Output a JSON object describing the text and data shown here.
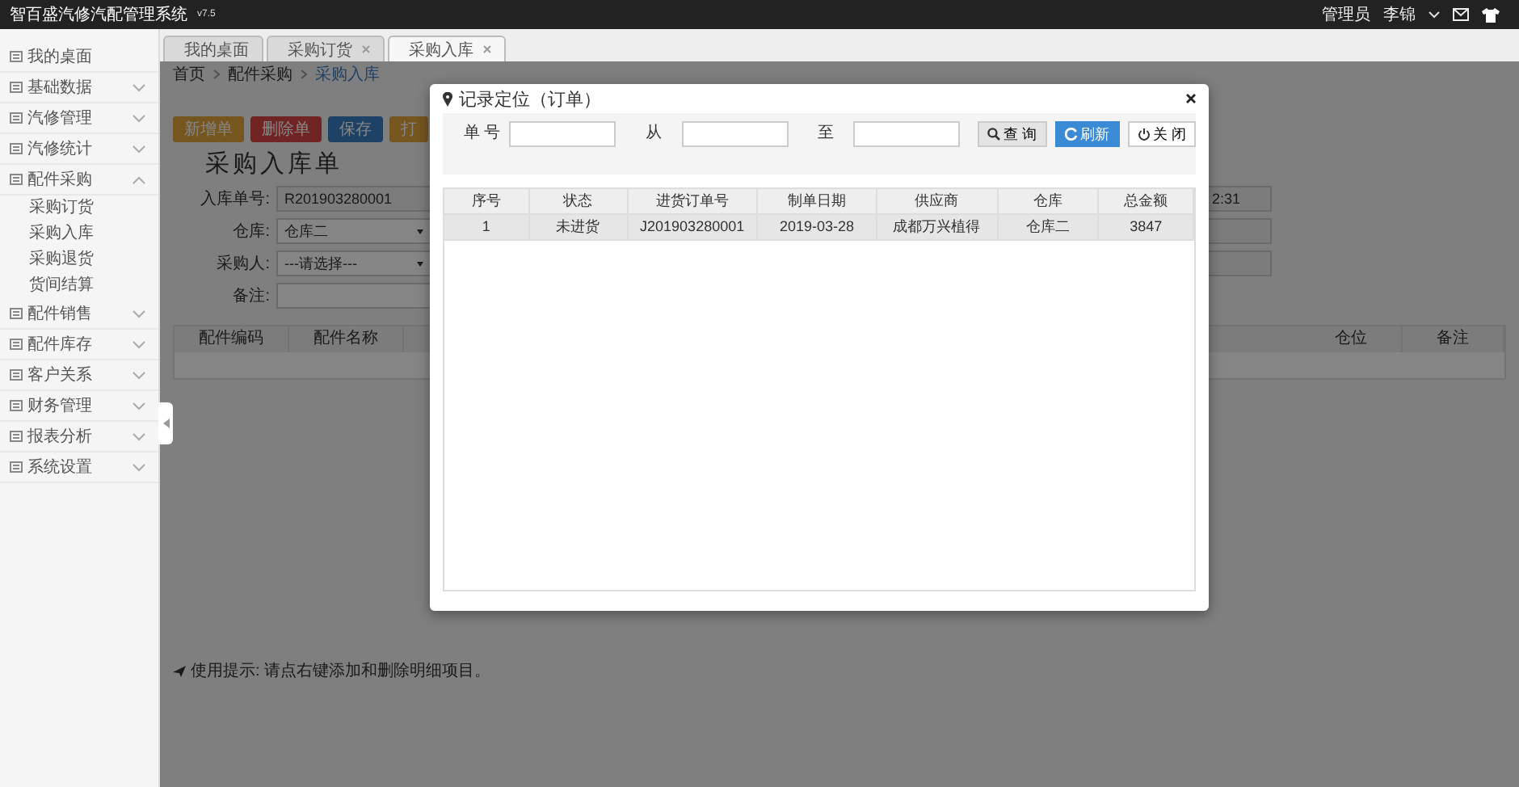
{
  "app": {
    "title": "智百盛汽修汽配管理系统",
    "version": "v7.5"
  },
  "user": {
    "role": "管理员",
    "name": "李锦"
  },
  "sidebar": {
    "items": [
      {
        "label": "我的桌面",
        "kind": "link"
      },
      {
        "label": "基础数据",
        "kind": "group",
        "expanded": false
      },
      {
        "label": "汽修管理",
        "kind": "group",
        "expanded": false
      },
      {
        "label": "汽修统计",
        "kind": "group",
        "expanded": false
      },
      {
        "label": "配件采购",
        "kind": "group",
        "expanded": true,
        "children": [
          {
            "label": "采购订货"
          },
          {
            "label": "采购入库"
          },
          {
            "label": "采购退货"
          },
          {
            "label": "货间结算"
          }
        ]
      },
      {
        "label": "配件销售",
        "kind": "group",
        "expanded": false
      },
      {
        "label": "配件库存",
        "kind": "group",
        "expanded": false
      },
      {
        "label": "客户关系",
        "kind": "group",
        "expanded": false
      },
      {
        "label": "财务管理",
        "kind": "group",
        "expanded": false
      },
      {
        "label": "报表分析",
        "kind": "group",
        "expanded": false
      },
      {
        "label": "系统设置",
        "kind": "group",
        "expanded": false
      }
    ]
  },
  "tabs": [
    {
      "label": "我的桌面",
      "closable": false,
      "selected": false
    },
    {
      "label": "采购订货",
      "closable": true,
      "selected": false
    },
    {
      "label": "采购入库",
      "closable": true,
      "selected": true
    }
  ],
  "breadcrumb": [
    "首页",
    "配件采购",
    "采购入库"
  ],
  "toolbar": [
    {
      "label": "新增单",
      "kind": "add"
    },
    {
      "label": "删除单",
      "kind": "delete"
    },
    {
      "label": "保存",
      "kind": "save"
    },
    {
      "label": "打",
      "kind": "print"
    }
  ],
  "form": {
    "title": "采购入库单",
    "fields": [
      {
        "label": "入库单号:",
        "value": "R201903280001",
        "kind": "readonly"
      },
      {
        "label": "仓库:",
        "value": "仓库二",
        "kind": "select"
      },
      {
        "label": "采购人:",
        "value": "---请选择---",
        "kind": "select"
      },
      {
        "label": "备注:",
        "kind": "text"
      }
    ],
    "right_value": "2:31"
  },
  "detail_table": {
    "left_columns": [
      "配件编码",
      "配件名称"
    ],
    "right_columns": [
      "仓位",
      "备注"
    ]
  },
  "tip": "使用提示: 请点右键添加和删除明细项目。",
  "dialog": {
    "title": "记录定位（订单）",
    "search_fields": [
      {
        "label": "单 号"
      },
      {
        "label": "从"
      },
      {
        "label": "至"
      }
    ],
    "buttons": [
      {
        "label": "查 询",
        "kind": "query"
      },
      {
        "label": "刷新",
        "kind": "refresh"
      },
      {
        "label": "关 闭",
        "kind": "close"
      }
    ],
    "columns": [
      "序号",
      "状态",
      "进货订单号",
      "制单日期",
      "供应商",
      "仓库",
      "总金额"
    ],
    "rows": [
      {
        "selected": true,
        "cells": [
          "1",
          "未进货",
          "J201903280001",
          "2019-03-28",
          "成都万兴植得",
          "仓库二",
          "3847"
        ]
      }
    ]
  }
}
